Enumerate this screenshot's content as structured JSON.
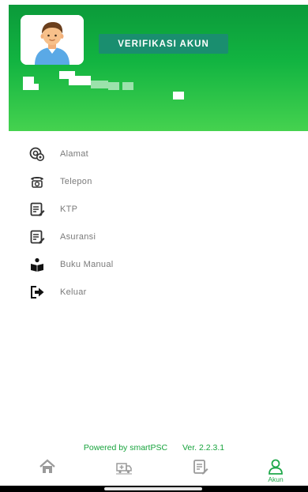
{
  "header": {
    "verify_button_label": "VERIFIKASI AKUN"
  },
  "menu": {
    "items": [
      {
        "label": "Alamat",
        "icon": "address-icon"
      },
      {
        "label": "Telepon",
        "icon": "telephone-icon"
      },
      {
        "label": "KTP",
        "icon": "id-card-icon"
      },
      {
        "label": "Asuransi",
        "icon": "insurance-icon"
      },
      {
        "label": "Buku Manual",
        "icon": "manual-book-icon"
      },
      {
        "label": "Keluar",
        "icon": "logout-icon"
      }
    ]
  },
  "footer": {
    "powered_by": "Powered by smartPSC",
    "version": "Ver. 2.2.3.1"
  },
  "bottom_nav": {
    "items": [
      {
        "icon": "home-icon",
        "label": ""
      },
      {
        "icon": "ambulance-icon",
        "label": ""
      },
      {
        "icon": "report-icon",
        "label": ""
      },
      {
        "icon": "account-icon",
        "label": "Akun"
      }
    ],
    "active_color": "#1fa84a"
  },
  "colors": {
    "header_green": "#12b441",
    "verify_button": "#1a8e6f",
    "icon_gray": "#555555",
    "label_gray": "#7a7a7a"
  }
}
